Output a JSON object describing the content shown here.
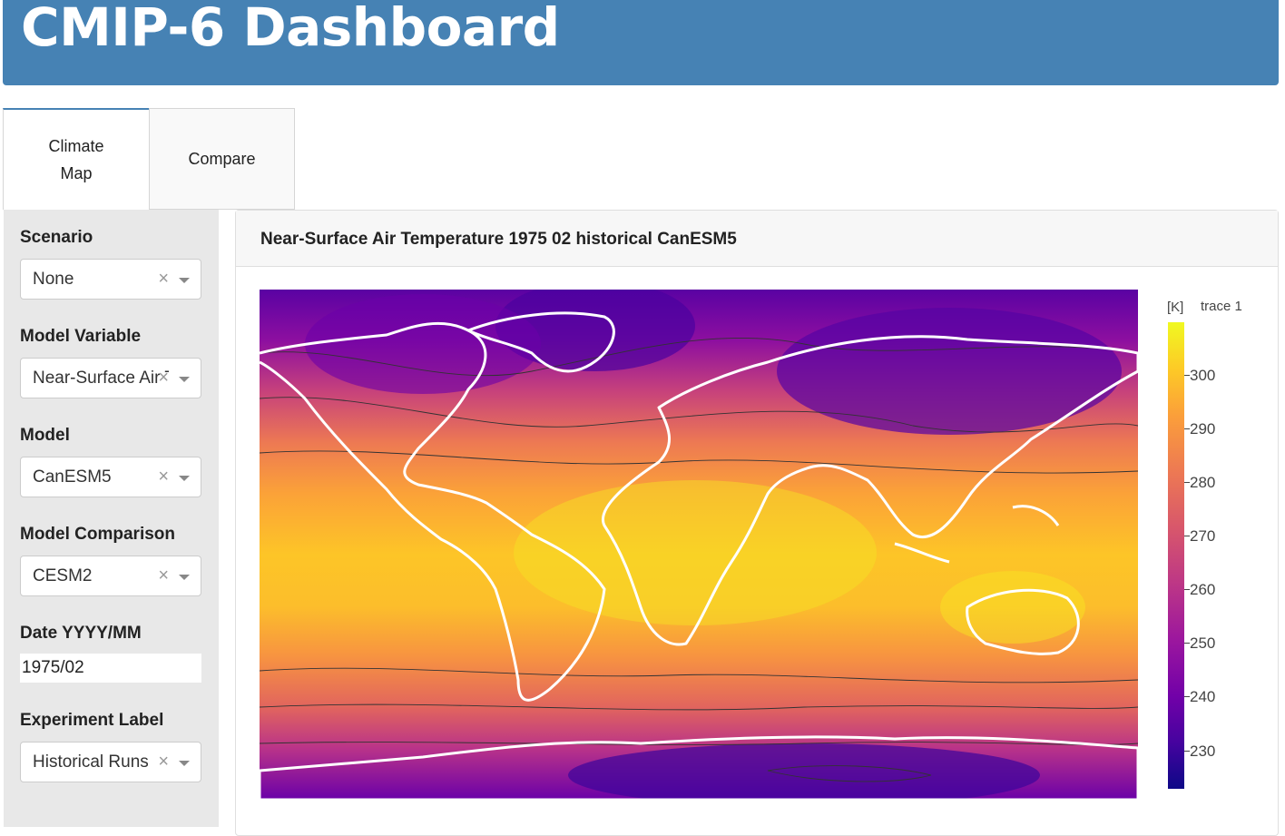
{
  "header": {
    "title": "CMIP-6 Dashboard"
  },
  "tabs": [
    {
      "label": "Climate Map",
      "active": true
    },
    {
      "label": "Compare",
      "active": false
    }
  ],
  "sidebar": {
    "scenario": {
      "label": "Scenario",
      "value": "None"
    },
    "model_variable": {
      "label": "Model Variable",
      "value": "Near-Surface Air Temperature"
    },
    "model": {
      "label": "Model",
      "value": "CanESM5"
    },
    "model_comparison": {
      "label": "Model Comparison",
      "value": "CESM2"
    },
    "date": {
      "label": "Date YYYY/MM",
      "value": "1975/02"
    },
    "experiment_label": {
      "label": "Experiment Label",
      "value": "Historical Runs"
    }
  },
  "icons": {
    "clear": "×",
    "dropdown": "chevron-down-icon"
  },
  "card": {
    "title": "Near-Surface Air Temperature 1975 02 historical CanESM5"
  },
  "colorbar": {
    "unit": "[K]",
    "trace": "trace 1",
    "ticks": [
      "300",
      "290",
      "280",
      "270",
      "260",
      "250",
      "240",
      "230"
    ],
    "colorscale": [
      "#0d0887",
      "#46039f",
      "#7201a8",
      "#9c179e",
      "#bd3786",
      "#d8576b",
      "#ed7953",
      "#fb9f3a",
      "#fdca26",
      "#f0f921"
    ]
  },
  "colors": {
    "header_bg": "#4682b4",
    "sidebar_bg": "#e8e8e8"
  }
}
